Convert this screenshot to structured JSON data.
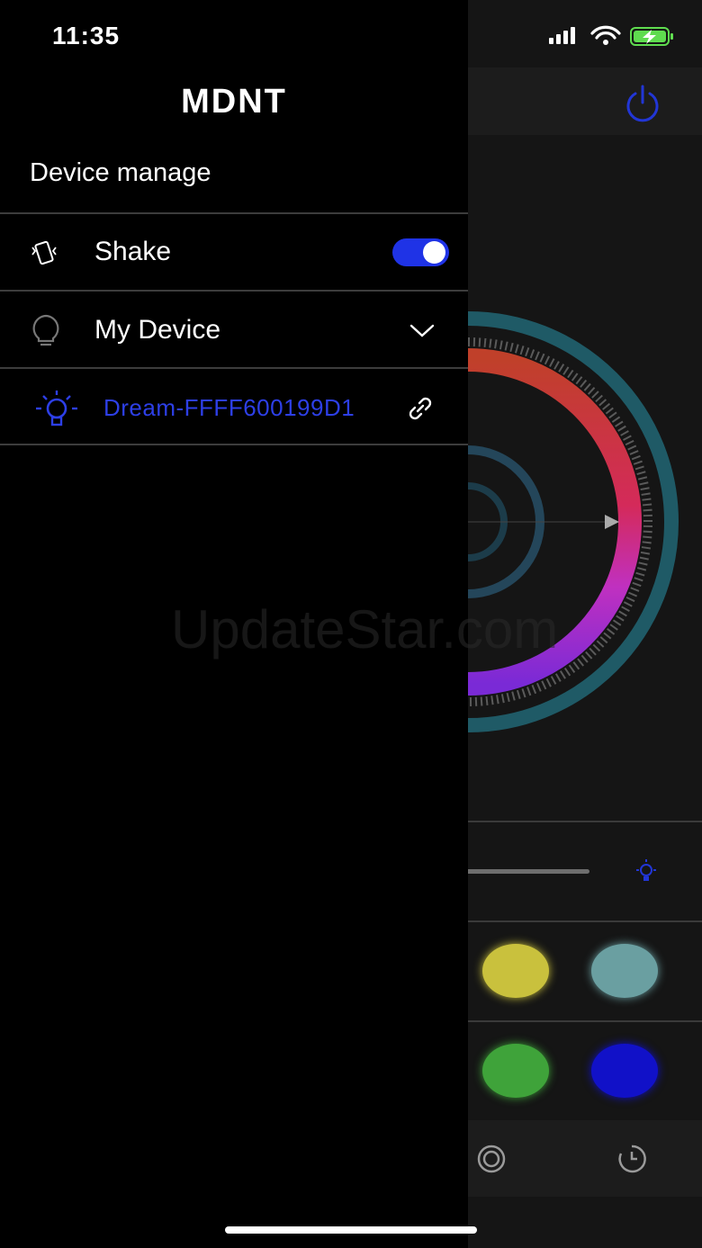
{
  "status_bar": {
    "time": "11:35",
    "icons": [
      "cellular-signal-icon",
      "wifi-icon",
      "battery-charging-icon"
    ]
  },
  "drawer": {
    "logo": "MDNT",
    "section_title": "Device manage",
    "shake": {
      "label": "Shake",
      "enabled": true,
      "icon": "shake-phone-icon"
    },
    "my_device": {
      "label": "My Device",
      "icon": "bulb-outline-icon",
      "expanded": true
    },
    "devices": [
      {
        "name": "Dream-FFFF600199D1",
        "icon": "bulb-glow-icon",
        "action_icon": "link-icon"
      }
    ]
  },
  "background_app": {
    "icons": [
      "power-icon",
      "bulb-glow-icon",
      "ring-icon",
      "timer-icon"
    ],
    "swatch_colors": [
      "#c9c13d",
      "#6a9fa1",
      "#3fa33a",
      "#1111c8"
    ],
    "accent_color": "#1f33e6"
  },
  "watermark": "UpdateStar.com"
}
